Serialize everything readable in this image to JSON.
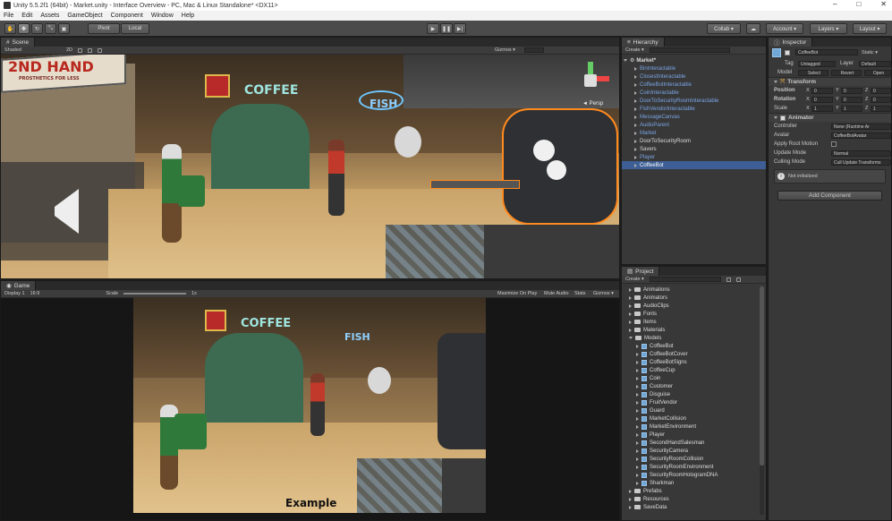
{
  "window": {
    "title": "Unity 5.5.2f1 (64bit) - Market.unity - Interface Overview - PC, Mac & Linux Standalone* <DX11>",
    "minimize": "–",
    "maximize": "□",
    "close": "✕"
  },
  "menu": [
    "File",
    "Edit",
    "Assets",
    "GameObject",
    "Component",
    "Window",
    "Help"
  ],
  "toolbar": {
    "pivot": "Pivot",
    "local": "Local",
    "play": "▶",
    "pause": "❚❚",
    "step": "▶|",
    "collab": "Collab ▾",
    "cloud": "☁",
    "account": "Account ▾",
    "layers": "Layers ▾",
    "layout": "Layout ▾"
  },
  "scene": {
    "tab": "Scene",
    "shading": "Shaded",
    "mode2d": "2D",
    "gizmos": "Gizmos ▾",
    "search_placeholder": "All",
    "persp": "◄ Persp",
    "signs": {
      "second_hand": "2ND HAND",
      "second_hand_sub": "PROSTHETICS FOR LESS",
      "coffee": "COFFEE",
      "fish": "FISH"
    }
  },
  "game": {
    "tab": "Game",
    "display": "Display 1",
    "aspect": "16:9",
    "scale_label": "Scale",
    "scale_value": "1x",
    "maximize": "Maximize On Play",
    "mute": "Mute Audio",
    "stats": "Stats",
    "gizmos": "Gizmos ▾",
    "caption": "Example",
    "signs": {
      "coffee": "COFFEE",
      "fish": "FISH"
    }
  },
  "hierarchy": {
    "tab": "Hierarchy",
    "create": "Create ▾",
    "search_placeholder": "All",
    "root": "Market*",
    "items": [
      {
        "label": "BinInteractable",
        "color": "blue"
      },
      {
        "label": "ClosestInteractable",
        "color": "blue"
      },
      {
        "label": "CoffeeBotInteractable",
        "color": "blue"
      },
      {
        "label": "CoinInteractable",
        "color": "blue"
      },
      {
        "label": "DoorToSecurityRoomInteractable",
        "color": "blue"
      },
      {
        "label": "FishVendorInteractable",
        "color": "blue"
      },
      {
        "label": "MessageCanvas",
        "color": "blue"
      },
      {
        "label": "AudioParent",
        "color": "blue"
      },
      {
        "label": "Market",
        "color": "blue"
      },
      {
        "label": "DoorToSecurityRoom",
        "color": "white"
      },
      {
        "label": "Savers",
        "color": "white"
      },
      {
        "label": "Player",
        "color": "blue"
      },
      {
        "label": "CoffeeBot",
        "color": "selected"
      }
    ]
  },
  "project": {
    "tab": "Project",
    "create": "Create ▾",
    "folders_top": [
      "Animations",
      "Animators",
      "AudioClips",
      "Fonts",
      "Items",
      "Materials"
    ],
    "models_folder": "Models",
    "models": [
      "CoffeeBot",
      "CoffeeBotCover",
      "CoffeeBotSigns",
      "CoffeeCup",
      "Coin",
      "Customer",
      "Disguise",
      "FruitVendor",
      "Guard",
      "MarketCollision",
      "MarketEnvironment",
      "Player",
      "SecondHandSalesman",
      "SecurityCamera",
      "SecurityRoomCollision",
      "SecurityRoomEnvironment",
      "SecurityRoomHologramDNA",
      "Sharkman"
    ],
    "folders_bottom": [
      "Prefabs",
      "Resources",
      "SaveData"
    ]
  },
  "inspector": {
    "tab": "Inspector",
    "object_name": "CoffeeBot",
    "static": "Static ▾",
    "tag_label": "Tag",
    "tag": "Untagged",
    "layer_label": "Layer",
    "layer": "Default",
    "model_label": "Model",
    "model_select": "Select",
    "model_revert": "Revert",
    "model_open": "Open",
    "transform": {
      "title": "Transform",
      "position_label": "Position",
      "rotation_label": "Rotation",
      "scale_label": "Scale",
      "position": [
        "0",
        "0",
        "0"
      ],
      "rotation": [
        "0",
        "0",
        "0"
      ],
      "scale": [
        "1",
        "1",
        "1"
      ]
    },
    "animator": {
      "title": "Animator",
      "controller_label": "Controller",
      "controller": "None (Runtime Ar",
      "avatar_label": "Avatar",
      "avatar": "CoffeeBotAvatar",
      "root_motion_label": "Apply Root Motion",
      "update_label": "Update Mode",
      "update": "Normal",
      "culling_label": "Culling Mode",
      "culling": "Cull Update Transforms",
      "info": "Not initialized"
    },
    "add_component": "Add Component"
  }
}
